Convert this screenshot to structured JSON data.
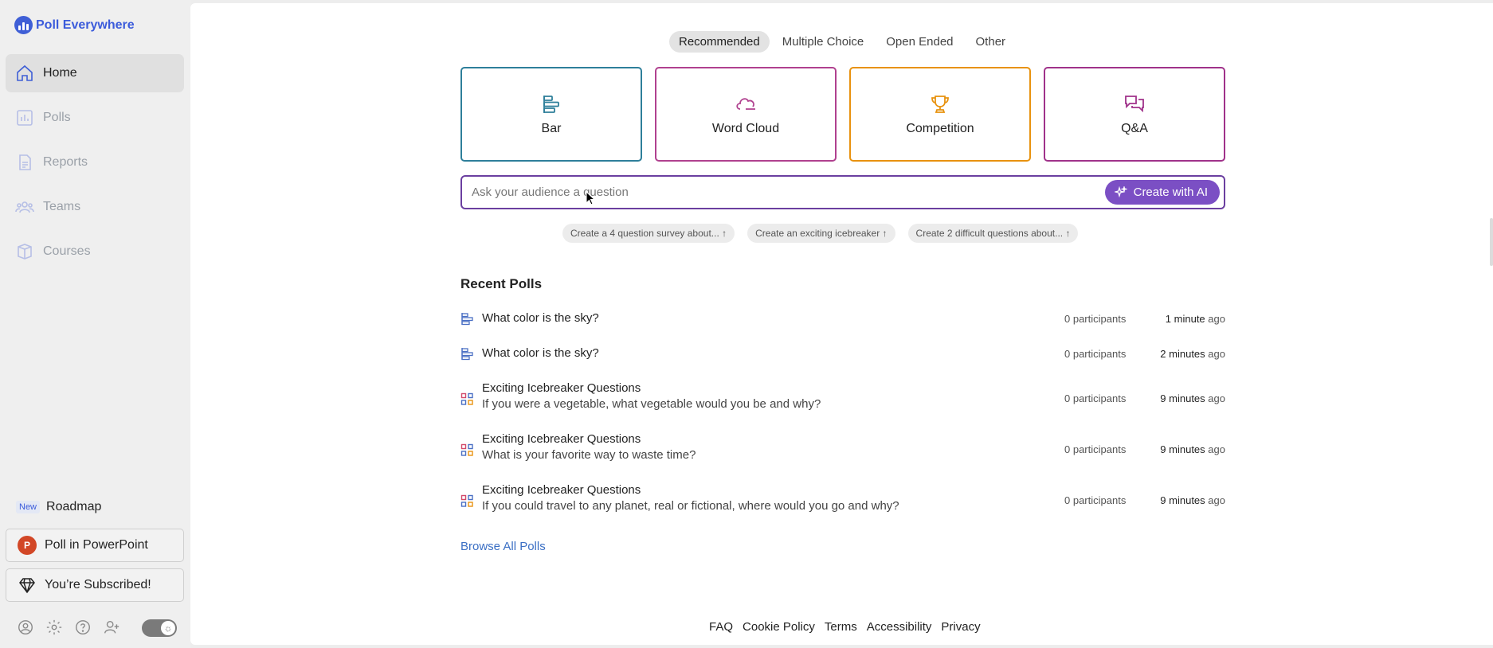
{
  "brand": {
    "name": "Poll Everywhere"
  },
  "sidebar": {
    "items": [
      {
        "label": "Home",
        "icon": "home-icon",
        "active": true
      },
      {
        "label": "Polls",
        "icon": "polls-icon",
        "active": false
      },
      {
        "label": "Reports",
        "icon": "reports-icon",
        "active": false
      },
      {
        "label": "Teams",
        "icon": "teams-icon",
        "active": false
      },
      {
        "label": "Courses",
        "icon": "courses-icon",
        "active": false
      }
    ],
    "roadmap_badge": "New",
    "roadmap_label": "Roadmap",
    "powerpoint_label": "Poll in PowerPoint",
    "subscribed_label": "You’re Subscribed!"
  },
  "tabs": [
    {
      "label": "Recommended",
      "active": true
    },
    {
      "label": "Multiple Choice",
      "active": false
    },
    {
      "label": "Open Ended",
      "active": false
    },
    {
      "label": "Other",
      "active": false
    }
  ],
  "cards": [
    {
      "label": "Bar",
      "icon": "bar-chart-icon",
      "color": "#2e7f9a"
    },
    {
      "label": "Word Cloud",
      "icon": "cloud-icon",
      "color": "#b0418f"
    },
    {
      "label": "Competition",
      "icon": "trophy-icon",
      "color": "#e8920f"
    },
    {
      "label": "Q&A",
      "icon": "chat-bubbles-icon",
      "color": "#a0328a"
    }
  ],
  "ask": {
    "placeholder": "Ask your audience a question",
    "ai_button": "Create with AI"
  },
  "suggestions": [
    "Create a 4 question survey about... ↑",
    "Create an exciting icebreaker ↑",
    "Create 2 difficult questions about... ↑"
  ],
  "recent": {
    "title": "Recent Polls",
    "polls": [
      {
        "title": "What color is the sky?",
        "subtitle": "",
        "participants": "0 participants",
        "time_value": "1 minute",
        "time_suffix": "ago",
        "icon": "bar-poll-icon"
      },
      {
        "title": "What color is the sky?",
        "subtitle": "",
        "participants": "0 participants",
        "time_value": "2 minutes",
        "time_suffix": "ago",
        "icon": "bar-poll-icon"
      },
      {
        "title": "Exciting Icebreaker Questions",
        "subtitle": "If you were a vegetable, what vegetable would you be and why?",
        "participants": "0 participants",
        "time_value": "9 minutes",
        "time_suffix": "ago",
        "icon": "grid-poll-icon"
      },
      {
        "title": "Exciting Icebreaker Questions",
        "subtitle": "What is your favorite way to waste time?",
        "participants": "0 participants",
        "time_value": "9 minutes",
        "time_suffix": "ago",
        "icon": "grid-poll-icon"
      },
      {
        "title": "Exciting Icebreaker Questions",
        "subtitle": "If you could travel to any planet, real or fictional, where would you go and why?",
        "participants": "0 participants",
        "time_value": "9 minutes",
        "time_suffix": "ago",
        "icon": "grid-poll-icon"
      }
    ],
    "browse_label": "Browse All Polls"
  },
  "footer": [
    "FAQ",
    "Cookie Policy",
    "Terms",
    "Accessibility",
    "Privacy"
  ],
  "colors": {
    "accent": "#7b4fc4",
    "brand": "#3b5bdb"
  }
}
